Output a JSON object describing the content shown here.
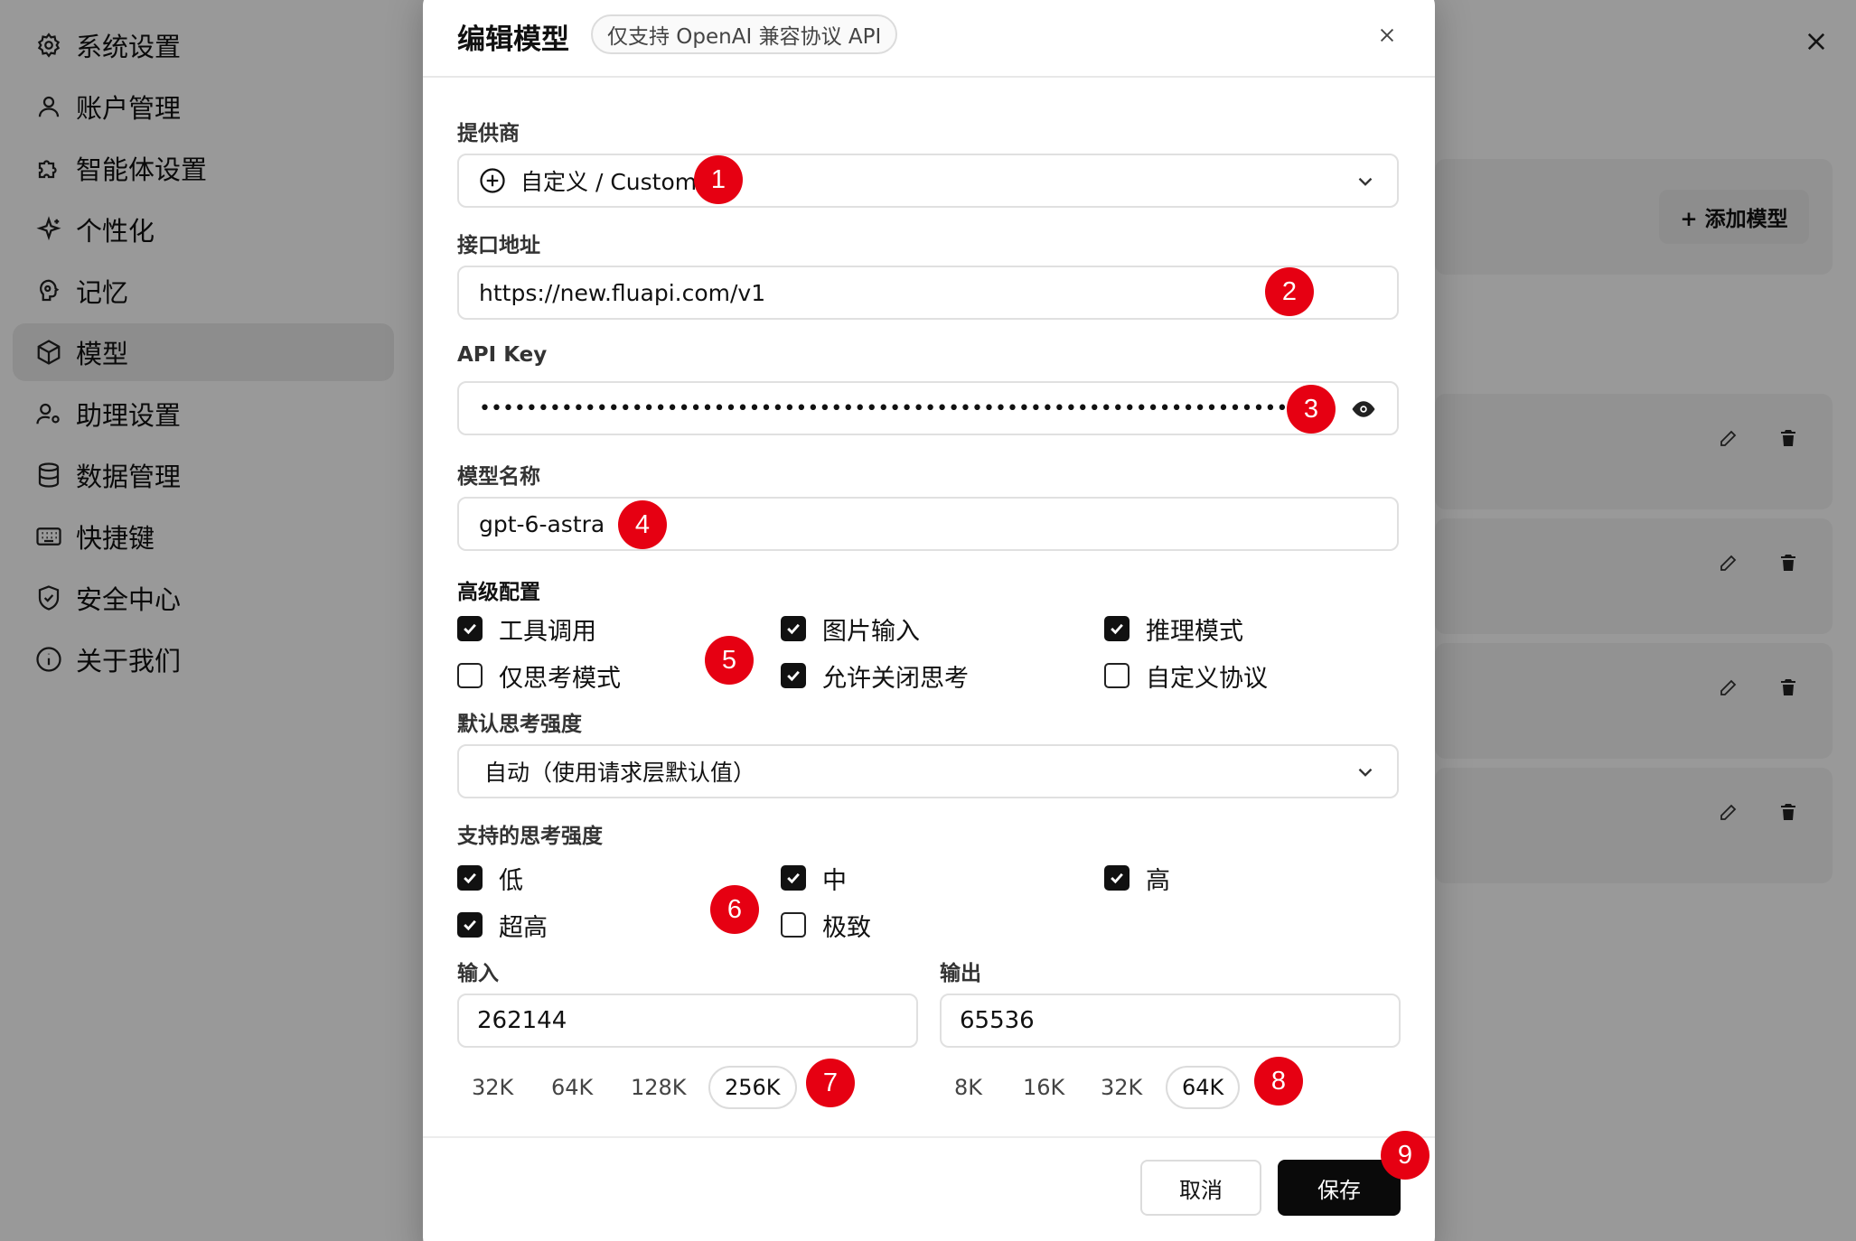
{
  "sidebar": {
    "items": [
      {
        "label": "系统设置",
        "icon": "gear-icon"
      },
      {
        "label": "账户管理",
        "icon": "user-icon"
      },
      {
        "label": "智能体设置",
        "icon": "puzzle-icon"
      },
      {
        "label": "个性化",
        "icon": "sparkle-icon"
      },
      {
        "label": "记忆",
        "icon": "brain-icon"
      },
      {
        "label": "模型",
        "icon": "cube-icon",
        "active": true
      },
      {
        "label": "助理设置",
        "icon": "user-gear-icon"
      },
      {
        "label": "数据管理",
        "icon": "database-icon"
      },
      {
        "label": "快捷键",
        "icon": "keyboard-icon"
      },
      {
        "label": "安全中心",
        "icon": "shield-icon"
      },
      {
        "label": "关于我们",
        "icon": "info-icon"
      }
    ]
  },
  "main": {
    "add_model_label": "+ 添加模型"
  },
  "modal": {
    "title": "编辑模型",
    "badge": "仅支持 OpenAI 兼容协议 API",
    "provider_label": "提供商",
    "provider_value": "自定义 / Custom",
    "endpoint_label": "接口地址",
    "endpoint_value": "https://new.fluapi.com/v1",
    "apikey_label": "API Key",
    "apikey_value": "••••••••••••••••••••••••••••••••••••••••••••••••••••••••••••••••••••••••••••••••••••••••",
    "model_name_label": "模型名称",
    "model_name_value": "gpt-6-astra",
    "advanced_label": "高级配置",
    "advanced": [
      {
        "label": "工具调用",
        "checked": true
      },
      {
        "label": "图片输入",
        "checked": true
      },
      {
        "label": "推理模式",
        "checked": true
      },
      {
        "label": "仅思考模式",
        "checked": false
      },
      {
        "label": "允许关闭思考",
        "checked": true
      },
      {
        "label": "自定义协议",
        "checked": false
      }
    ],
    "default_effort_label": "默认思考强度",
    "default_effort_value": "自动（使用请求层默认值）",
    "supported_effort_label": "支持的思考强度",
    "efforts": [
      {
        "label": "低",
        "checked": true
      },
      {
        "label": "中",
        "checked": true
      },
      {
        "label": "高",
        "checked": true
      },
      {
        "label": "超高",
        "checked": true
      },
      {
        "label": "极致",
        "checked": false
      }
    ],
    "input_label": "输入",
    "input_value": "262144",
    "input_chips": [
      "32K",
      "64K",
      "128K",
      "256K"
    ],
    "input_selected": "256K",
    "output_label": "输出",
    "output_value": "65536",
    "output_chips": [
      "8K",
      "16K",
      "32K",
      "64K"
    ],
    "output_selected": "64K",
    "cancel_label": "取消",
    "save_label": "保存"
  },
  "markers": [
    "1",
    "2",
    "3",
    "4",
    "5",
    "6",
    "7",
    "8",
    "9"
  ],
  "colors": {
    "marker": "#e60012",
    "primary_button": "#0a0a0a"
  }
}
